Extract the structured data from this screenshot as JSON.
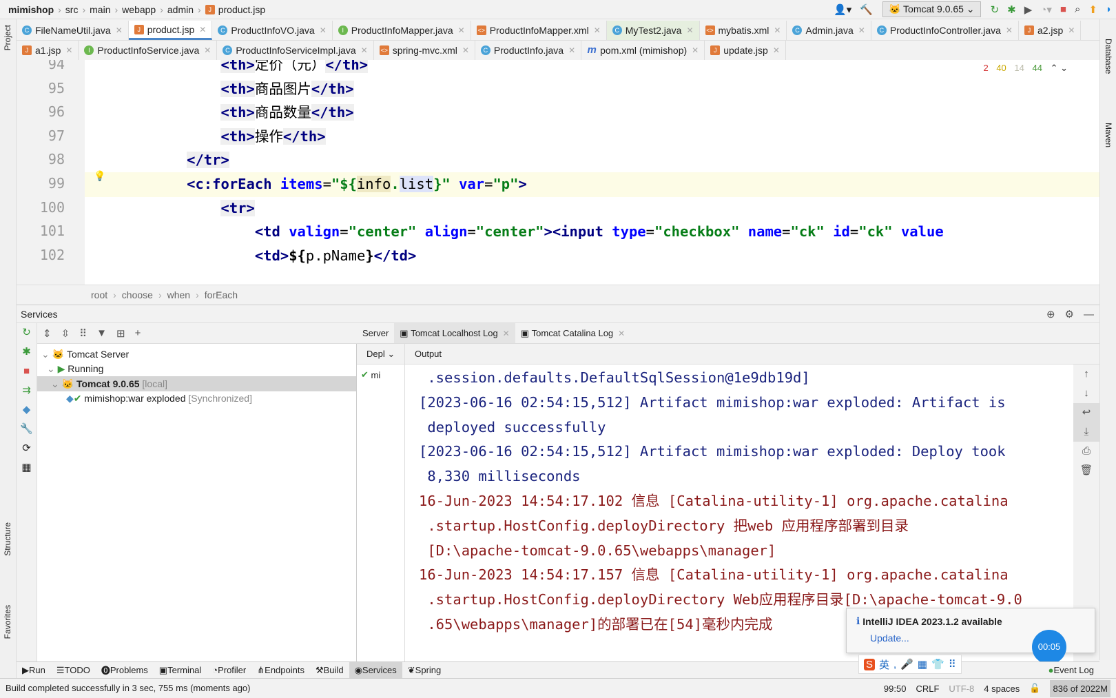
{
  "breadcrumb": [
    "mimishop",
    "src",
    "main",
    "webapp",
    "admin",
    "product.jsp"
  ],
  "toolbar": {
    "run_config": "Tomcat 9.0.65"
  },
  "tabs_row1": [
    {
      "label": "FileNameUtil.java",
      "icon": "c"
    },
    {
      "label": "product.jsp",
      "icon": "jsp",
      "active": true
    },
    {
      "label": "ProductInfoVO.java",
      "icon": "c"
    },
    {
      "label": "ProductInfoMapper.java",
      "icon": "i"
    },
    {
      "label": "ProductInfoMapper.xml",
      "icon": "xml"
    },
    {
      "label": "MyTest2.java",
      "icon": "c",
      "green": true
    },
    {
      "label": "mybatis.xml",
      "icon": "xml"
    },
    {
      "label": "Admin.java",
      "icon": "c"
    },
    {
      "label": "ProductInfoController.java",
      "icon": "c"
    },
    {
      "label": "a2.jsp",
      "icon": "jsp"
    }
  ],
  "tabs_row2": [
    {
      "label": "a1.jsp",
      "icon": "jsp"
    },
    {
      "label": "ProductInfoService.java",
      "icon": "i"
    },
    {
      "label": "ProductInfoServiceImpl.java",
      "icon": "c"
    },
    {
      "label": "spring-mvc.xml",
      "icon": "xml"
    },
    {
      "label": "ProductInfo.java",
      "icon": "c"
    },
    {
      "label": "pom.xml (mimishop)",
      "icon": "m"
    },
    {
      "label": "update.jsp",
      "icon": "jsp"
    }
  ],
  "side": {
    "project": "Project",
    "structure": "Structure",
    "favorites": "Favorites",
    "database": "Database",
    "maven": "Maven"
  },
  "inspections": {
    "errors": "2",
    "warnings": "40",
    "weak": "14",
    "ok": "44"
  },
  "editor": {
    "lines": [
      {
        "n": "94",
        "html": "                <span class='tg hl'>&lt;th&gt;</span>定价（元）<span class='tg hl'>&lt;/th&gt;</span>"
      },
      {
        "n": "95",
        "html": "                <span class='tg hl'>&lt;th&gt;</span>商品图片<span class='tg hl'>&lt;/th&gt;</span>"
      },
      {
        "n": "96",
        "html": "                <span class='tg hl'>&lt;th&gt;</span>商品数量<span class='tg hl'>&lt;/th&gt;</span>"
      },
      {
        "n": "97",
        "html": "                <span class='tg hl'>&lt;th&gt;</span>操作<span class='tg hl'>&lt;/th&gt;</span>"
      },
      {
        "n": "98",
        "html": "            <span class='tg hl'>&lt;/tr&gt;</span>"
      },
      {
        "n": "99",
        "html": "            <span class='tg'>&lt;c:forEach</span> <span class='at'>items</span>=<span class='st'>\"${<span style='background:#efe9c4;color:#000;font-weight:normal'>info</span>.<span style='background:#dde3fa;color:#000;font-weight:normal'>list</span>}\"</span> <span class='at'>var</span>=<span class='st'>\"p\"</span><span class='tg'>&gt;</span>",
        "cur": true
      },
      {
        "n": "100",
        "html": "                <span class='tg hl'>&lt;tr&gt;</span>"
      },
      {
        "n": "101",
        "html": "                    <span class='tg'>&lt;td</span> <span class='at'>valign</span>=<span class='st'>\"center\"</span> <span class='at'>align</span>=<span class='st'>\"center\"</span><span class='tg'>&gt;&lt;input</span> <span class='at'>type</span>=<span class='st'>\"checkbox\"</span> <span class='at'>name</span>=<span class='st'>\"ck\"</span> <span class='at'>id</span>=<span class='st'>\"ck\"</span> <span class='at'>value</span>"
      },
      {
        "n": "102",
        "html": "                    <span class='tg'>&lt;td&gt;</span><b>${</b>p.pName<b>}</b><span class='tg'>&lt;/td&gt;</span>"
      }
    ]
  },
  "editor_breadcrumb": [
    "root",
    "choose",
    "when",
    "forEach"
  ],
  "services": {
    "title": "Services",
    "tree": {
      "server": "Tomcat Server",
      "running": "Running",
      "instance": "Tomcat 9.0.65",
      "instance_tag": "[local]",
      "artifact": "mimishop:war exploded",
      "artifact_tag": "[Synchronized]"
    },
    "tabs": [
      "Server",
      "Tomcat Localhost Log",
      "Tomcat Catalina Log"
    ],
    "deploy_header": "Depl",
    "deploy_item": "mi",
    "output_header": "Output",
    "log": [
      {
        "t": " .session.defaults.DefaultSqlSession@1e9db19d]",
        "c": "blue"
      },
      {
        "t": "[2023-06-16 02:54:15,512] Artifact mimishop:war exploded: Artifact is",
        "c": "blue"
      },
      {
        "t": " deployed successfully",
        "c": "blue"
      },
      {
        "t": "[2023-06-16 02:54:15,512] Artifact mimishop:war exploded: Deploy took",
        "c": "blue"
      },
      {
        "t": " 8,330 milliseconds",
        "c": "blue"
      },
      {
        "t": "16-Jun-2023 14:54:17.102 信息 [Catalina-utility-1] org.apache.catalina",
        "c": "red"
      },
      {
        "t": " .startup.HostConfig.deployDirectory 把web 应用程序部署到目录",
        "c": "red"
      },
      {
        "t": " [D:\\apache-tomcat-9.0.65\\webapps\\manager]",
        "c": "red"
      },
      {
        "t": "16-Jun-2023 14:54:17.157 信息 [Catalina-utility-1] org.apache.catalina",
        "c": "red"
      },
      {
        "t": " .startup.HostConfig.deployDirectory Web应用程序目录[D:\\apache-tomcat-9.0",
        "c": "red"
      },
      {
        "t": " .65\\webapps\\manager]的部署已在[54]毫秒内完成",
        "c": "red"
      }
    ]
  },
  "notification": {
    "title": "IntelliJ IDEA 2023.1.2 available",
    "action": "Update..."
  },
  "timer": "00:05",
  "ime": {
    "lang": "英"
  },
  "tool_windows": [
    "Run",
    "TODO",
    "Problems",
    "Terminal",
    "Profiler",
    "Endpoints",
    "Build",
    "Services",
    "Spring"
  ],
  "event_log": "Event Log",
  "status": {
    "message": "Build completed successfully in 3 sec, 755 ms (moments ago)",
    "position": "99:50",
    "line_sep": "CRLF",
    "encoding": "UTF-8",
    "indent": "4 spaces",
    "memory": "836 of 2022M"
  }
}
